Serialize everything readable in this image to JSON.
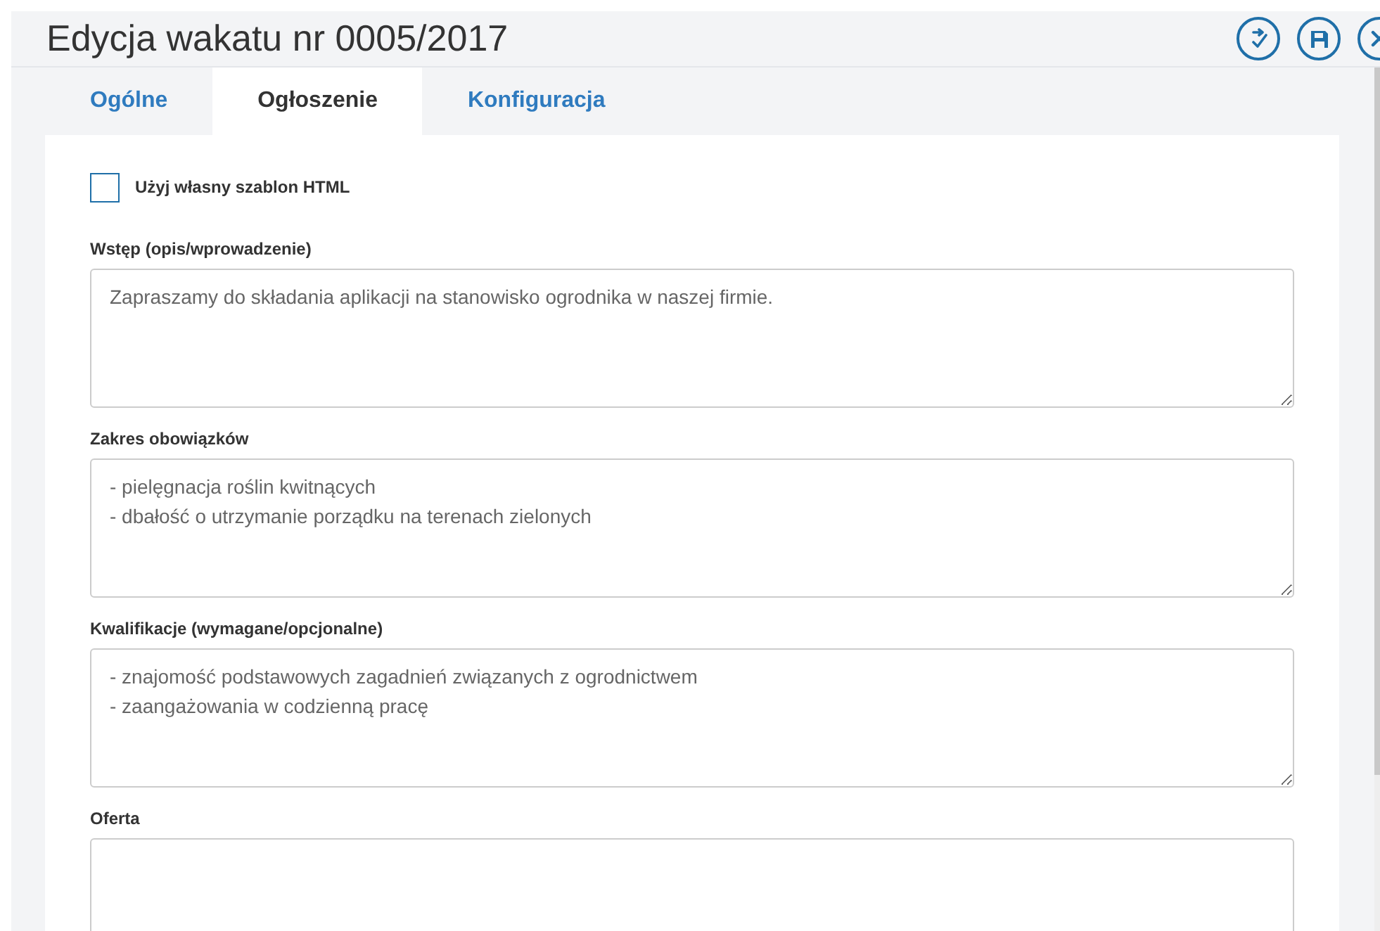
{
  "header": {
    "title": "Edycja wakatu nr 0005/2017",
    "actions": [
      {
        "kind": "accept"
      },
      {
        "kind": "save"
      },
      {
        "kind": "close"
      }
    ]
  },
  "tabs": [
    {
      "label": "Ogólne",
      "selected": false
    },
    {
      "label": "Ogłoszenie",
      "selected": true
    },
    {
      "label": "Konfiguracja",
      "selected": false
    }
  ],
  "form": {
    "checkbox": {
      "label": "Użyj własny szablon HTML",
      "checked": false
    },
    "fields": [
      {
        "label": "Wstęp (opis/wprowadzenie)",
        "value": "Zapraszamy do składania aplikacji na stanowisko ogrodnika w naszej firmie."
      },
      {
        "label": "Zakres obowiązków",
        "value": "- pielęgnacja roślin kwitnących\n- dbałość o utrzymanie porządku na terenach zielonych"
      },
      {
        "label": "Kwalifikacje (wymagane/opcjonalne)",
        "value": "- znajomość podstawowych zagadnień związanych z ogrodnictwem\n- zaangażowania w codzienną pracę"
      },
      {
        "label": "Oferta"
      }
    ]
  }
}
